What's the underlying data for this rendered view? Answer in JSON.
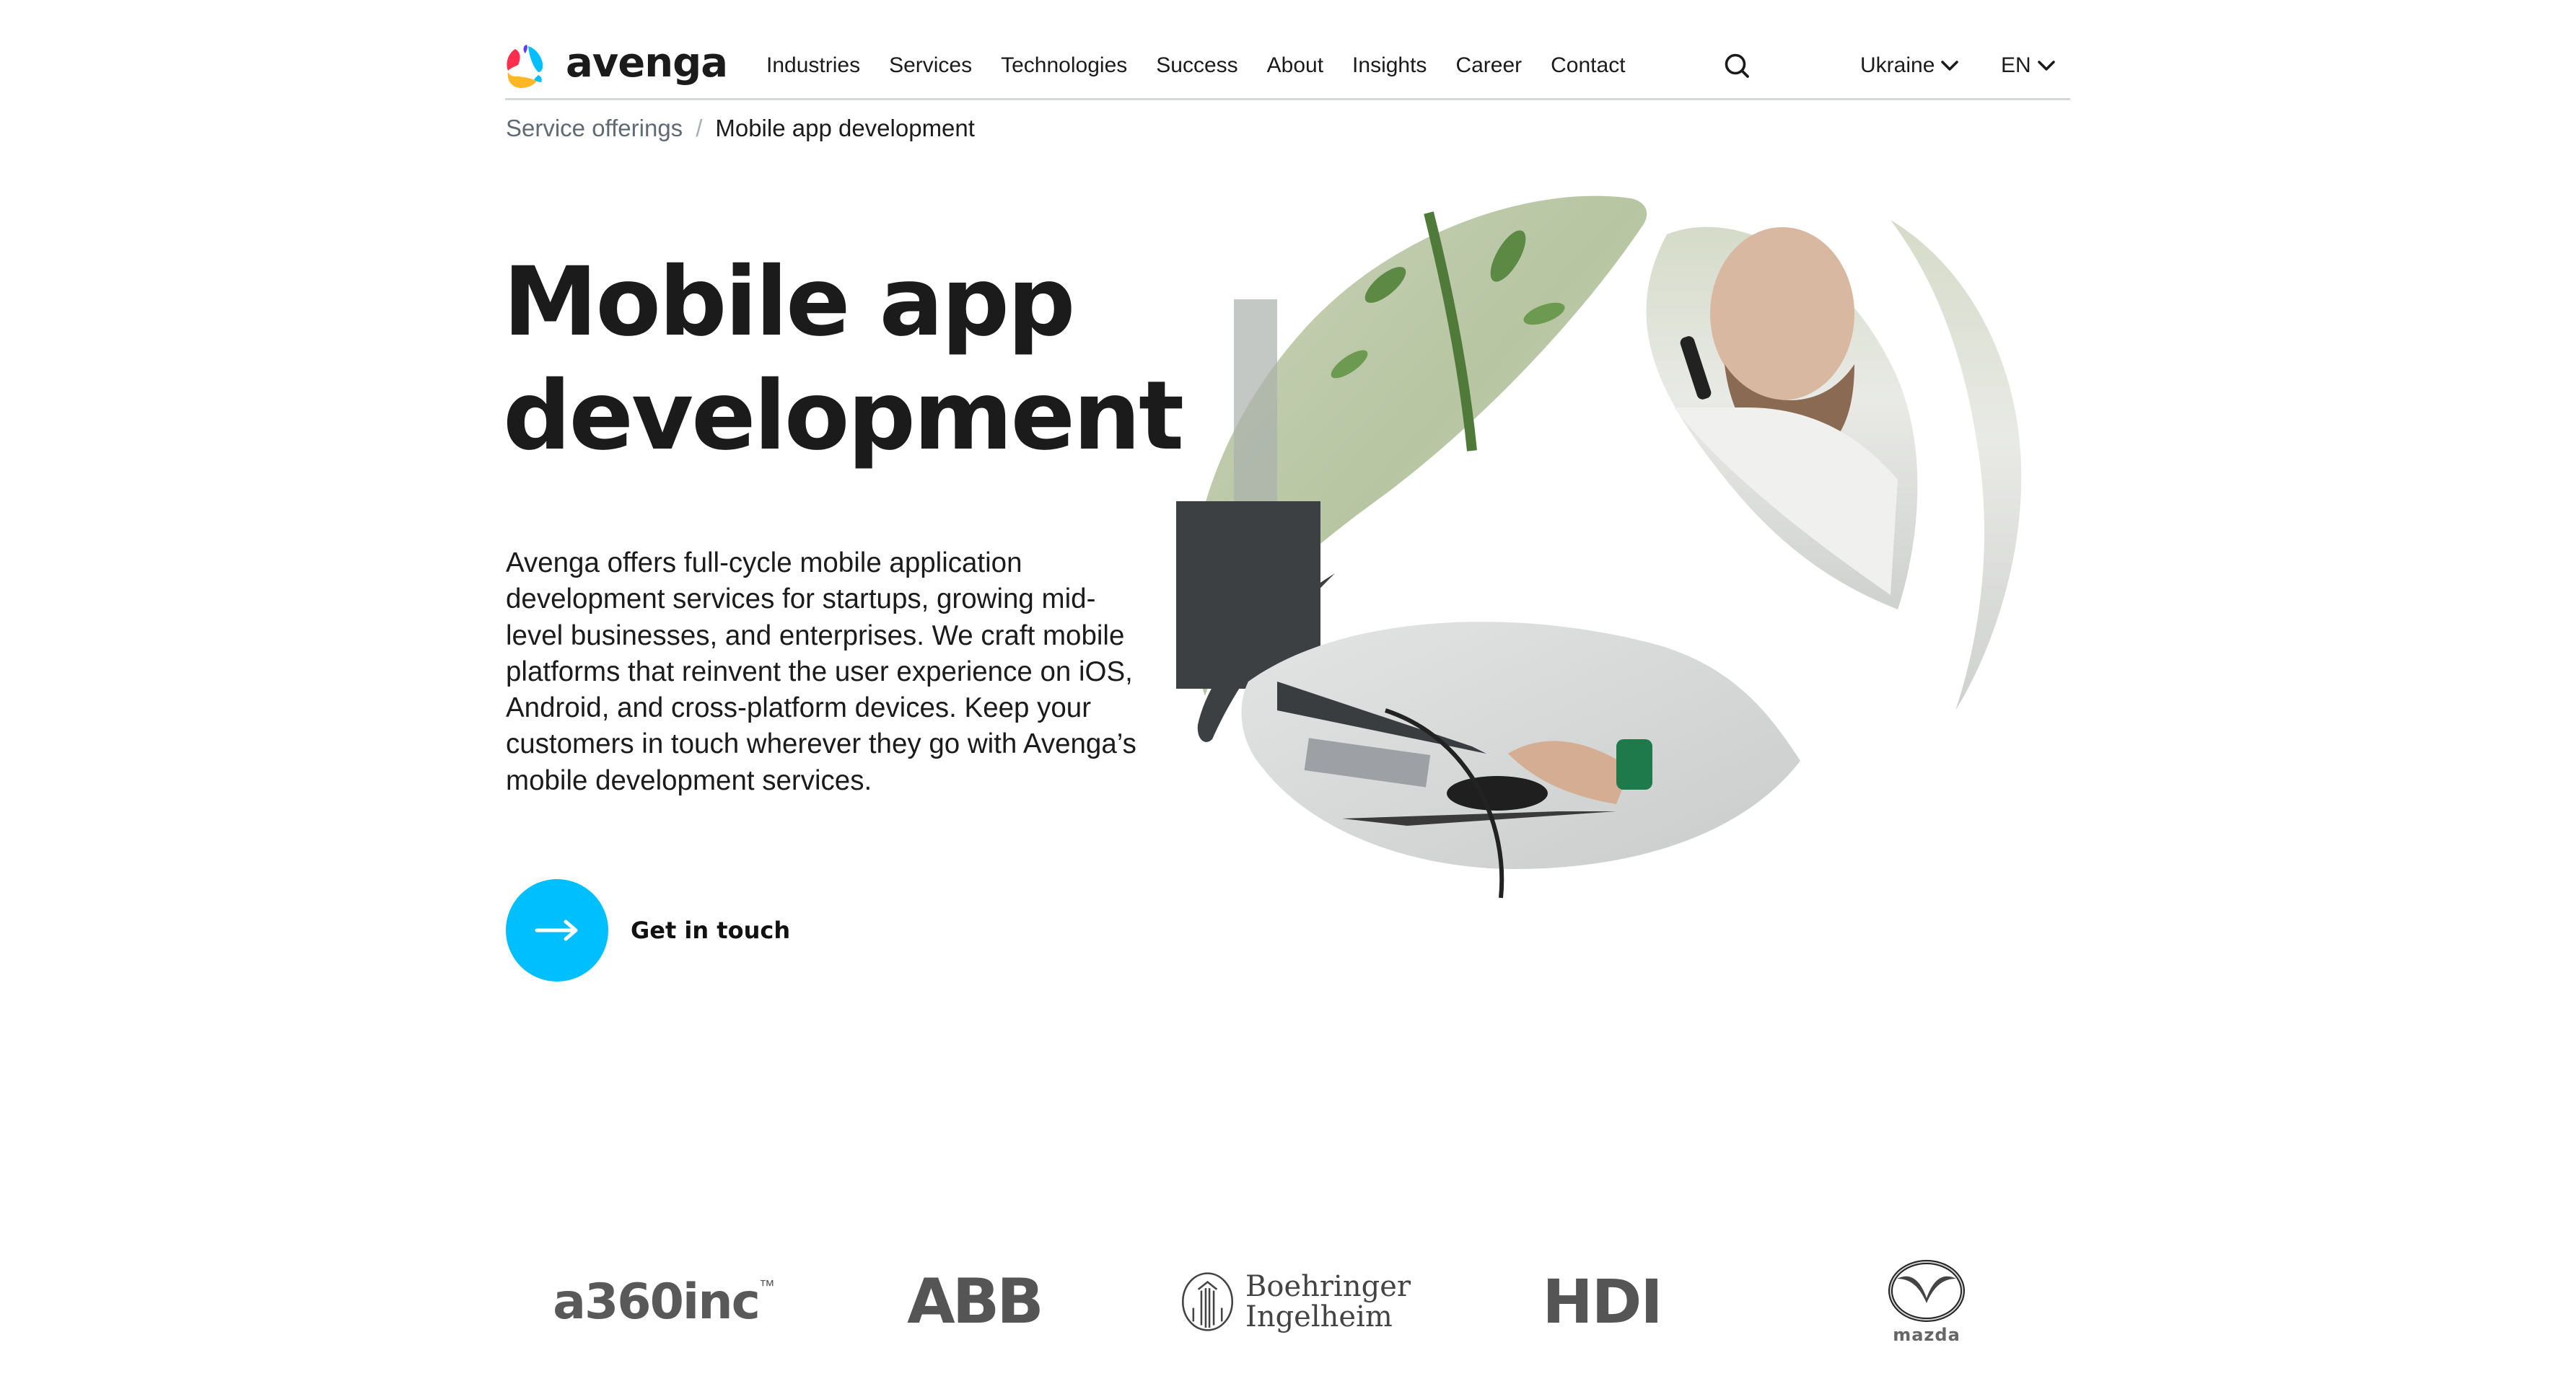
{
  "brand": {
    "name": "avenga",
    "accent_color": "#00bfff",
    "logo_colors": [
      "#ff2e4c",
      "#5b3df5",
      "#00bfff",
      "#ffb627"
    ]
  },
  "nav": {
    "items": [
      {
        "label": "Industries"
      },
      {
        "label": "Services"
      },
      {
        "label": "Technologies"
      },
      {
        "label": "Success"
      },
      {
        "label": "About"
      },
      {
        "label": "Insights"
      },
      {
        "label": "Career"
      },
      {
        "label": "Contact"
      }
    ],
    "search_icon": "search-icon",
    "region": "Ukraine",
    "language": "EN"
  },
  "breadcrumb": {
    "parent": "Service offerings",
    "separator": "/",
    "current": "Mobile app development"
  },
  "hero": {
    "title_line1": "Mobile app",
    "title_line2": "development",
    "description": "Avenga offers full-cycle mobile application development services for startups, growing mid-level businesses, and enterprises. We craft mobile platforms that reinvent the user experience on iOS, Android, and cross-platform devices. Keep your customers in touch wherever they go with Avenga’s mobile development services.",
    "cta_label": "Get in touch",
    "cta_icon": "arrow-right-icon",
    "image_alt": "Man on phone at office desk, hand on mouse"
  },
  "clients": [
    {
      "name": "a360inc",
      "mark": "™"
    },
    {
      "name": "ABB"
    },
    {
      "name_line1": "Boehringer",
      "name_line2": "Ingelheim"
    },
    {
      "name": "HDI"
    },
    {
      "name": "mazda"
    }
  ]
}
